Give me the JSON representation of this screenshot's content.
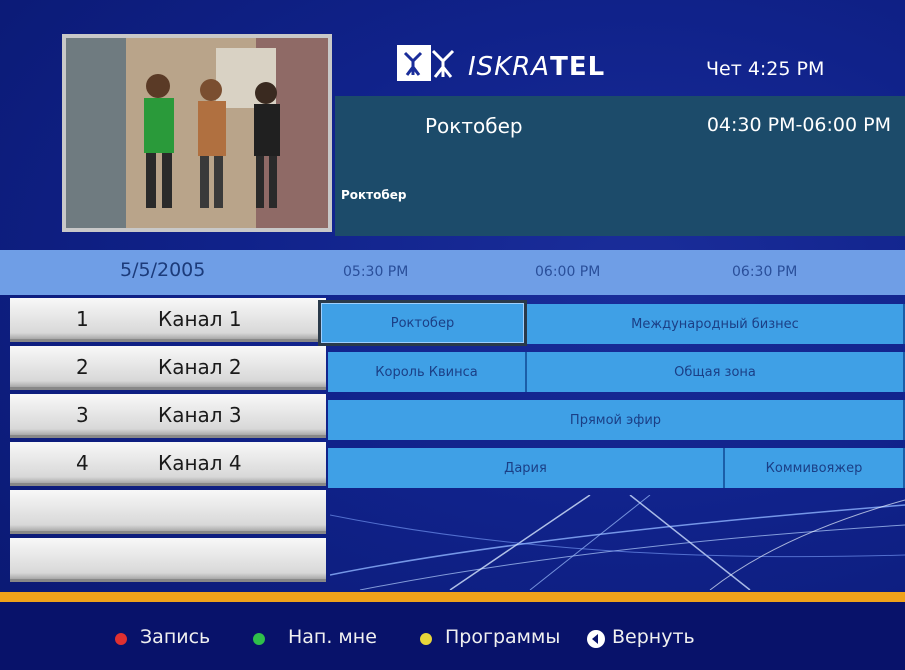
{
  "brand": {
    "prefix": "ISKRA",
    "suffix": "TEL"
  },
  "clock": "Чет 4:25 PM",
  "now_playing": {
    "title": "Роктобер",
    "time": "04:30 PM-06:00 PM",
    "description": "Роктобер"
  },
  "timeline": {
    "date": "5/5/2005",
    "ticks": [
      "05:30 PM",
      "06:00 PM",
      "06:30 PM"
    ]
  },
  "channels": [
    {
      "number": "1",
      "name": "Канал  1"
    },
    {
      "number": "2",
      "name": "Канал  2"
    },
    {
      "number": "3",
      "name": "Канал  3"
    },
    {
      "number": "4",
      "name": "Канал  4"
    }
  ],
  "programs": {
    "row1": [
      "Роктобер",
      "Международный бизнес"
    ],
    "row2": [
      "Король Квинса",
      "Общая зона"
    ],
    "row3": [
      "Прямой эфир"
    ],
    "row4": [
      "Дария",
      "Коммивояжер"
    ]
  },
  "footer": {
    "record": "Запись",
    "remind": "Нап. мне",
    "programs": "Программы",
    "back": "Вернуть",
    "colors": {
      "red": "#e03030",
      "green": "#2fbf4a",
      "yellow": "#e8d63a"
    }
  }
}
